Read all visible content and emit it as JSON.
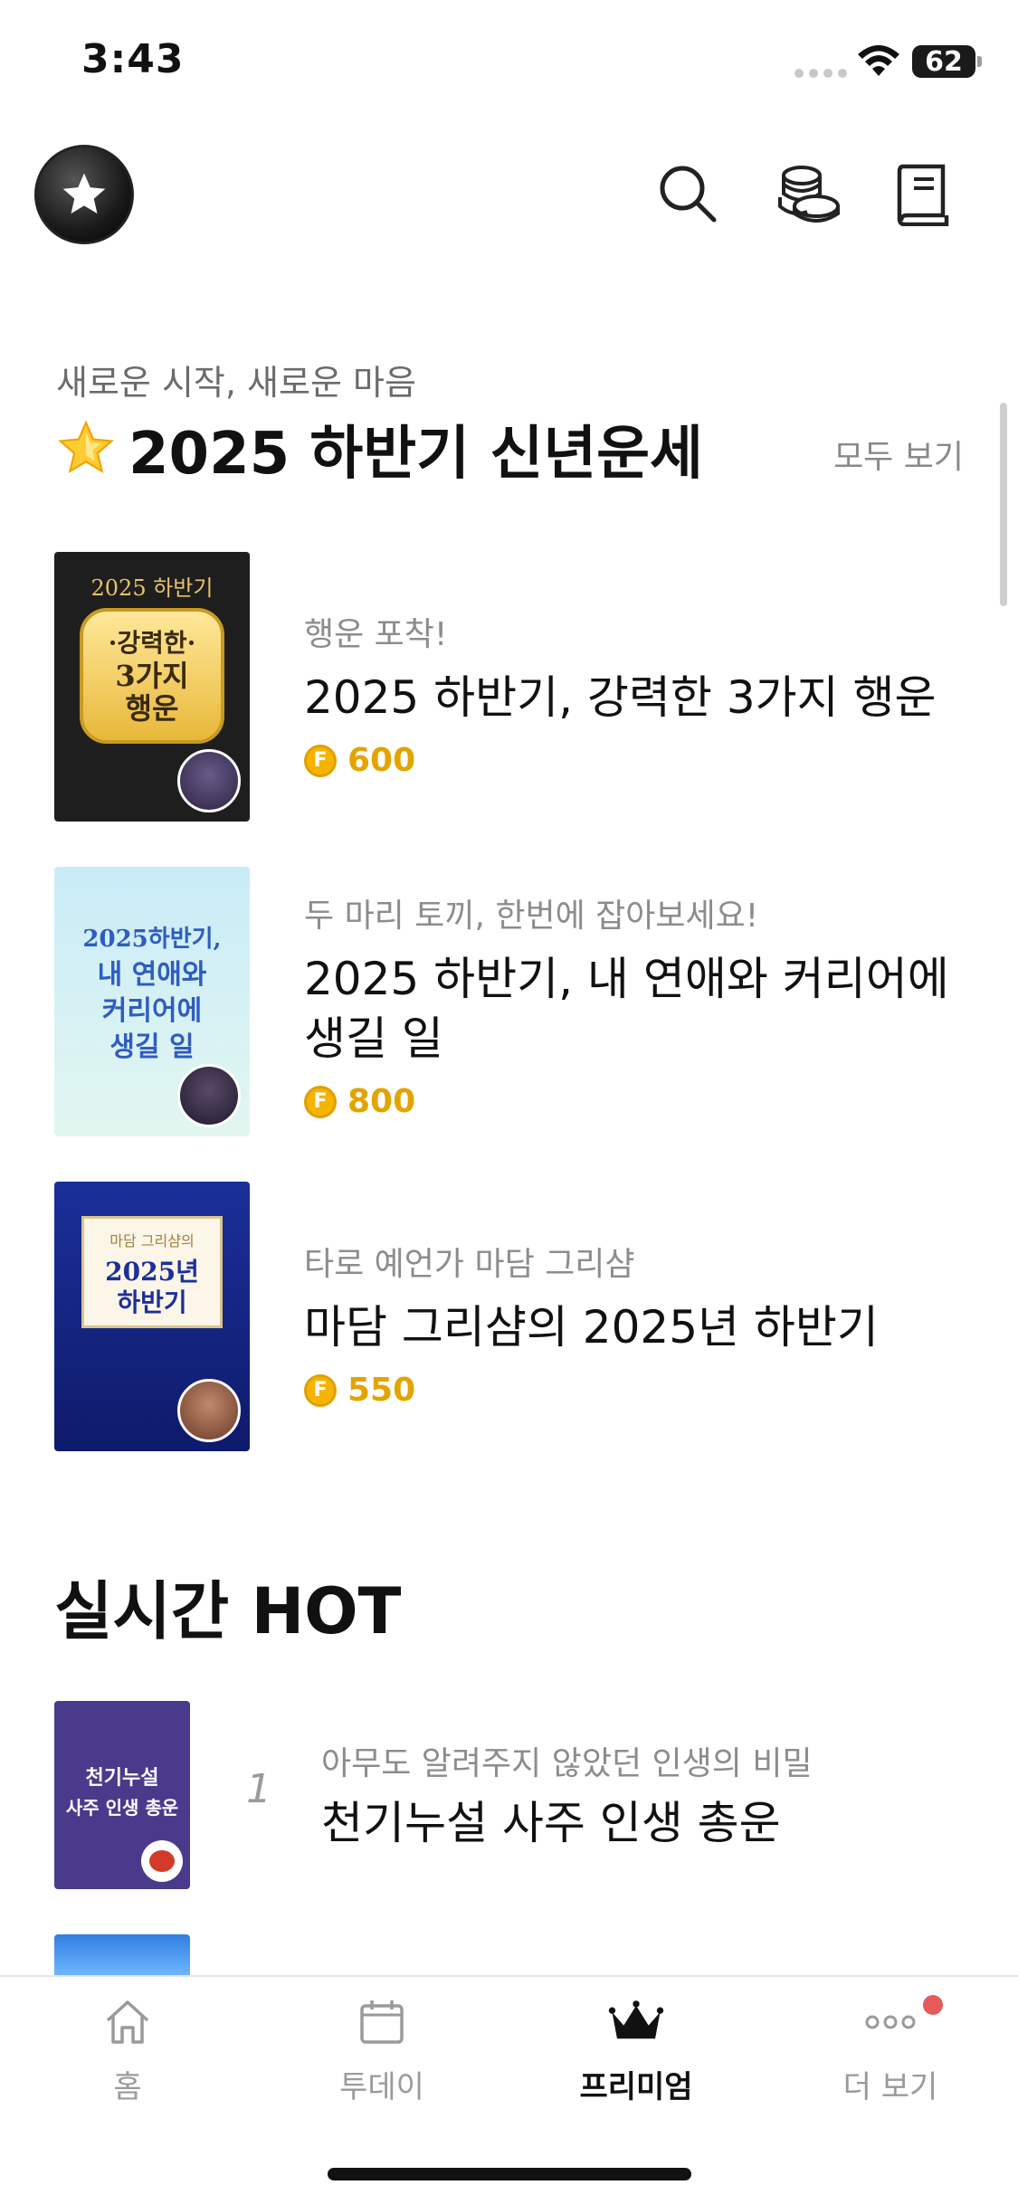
{
  "status_bar": {
    "time": "3:43",
    "battery": "62"
  },
  "header": {
    "logo_icon": "star-logo-icon",
    "actions": [
      {
        "name": "search-icon"
      },
      {
        "name": "coins-icon"
      },
      {
        "name": "book-icon"
      }
    ]
  },
  "featured": {
    "subtitle": "새로운 시작, 새로운 마음",
    "title": "2025 하반기 신년운세",
    "see_all": "모두 보기",
    "items": [
      {
        "thumb_text": [
          "2025 하반기",
          "·강력한·",
          "3가지",
          "행운"
        ],
        "subtitle": "행운 포착!",
        "title_lines": [
          "2025 하반기, 강력한 3가지 행운"
        ],
        "price": "600"
      },
      {
        "thumb_text": [
          "2025하반기,",
          "내 연애와",
          "커리어에",
          "생길 일"
        ],
        "subtitle": "두 마리 토끼, 한번에 잡아보세요!",
        "title_lines": [
          "2025 하반기, 내 연애와 커리어에",
          "생길 일"
        ],
        "price": "800"
      },
      {
        "thumb_text": [
          "마담 그리샴의",
          "2025년",
          "하반기"
        ],
        "subtitle": "타로 예언가 마담 그리샴",
        "title_lines": [
          "마담 그리샴의 2025년 하반기"
        ],
        "price": "550"
      }
    ]
  },
  "hot": {
    "title": "실시간 HOT",
    "items": [
      {
        "rank": "1",
        "thumb_text": [
          "천기누설",
          "사주 인생 총운"
        ],
        "subtitle": "아무도 알려주지 않았던 인생의 비밀",
        "title": "천기누설 사주 인생 총운"
      }
    ]
  },
  "coin_symbol": "F",
  "colors": {
    "accent_gold": "#e2a500",
    "badge_red": "#e65a5a"
  },
  "tabs": [
    {
      "label": "홈",
      "icon": "home-icon",
      "active": false
    },
    {
      "label": "투데이",
      "icon": "calendar-icon",
      "active": false
    },
    {
      "label": "프리미엄",
      "icon": "crown-icon",
      "active": true
    },
    {
      "label": "더 보기",
      "icon": "more-icon",
      "active": false
    }
  ]
}
